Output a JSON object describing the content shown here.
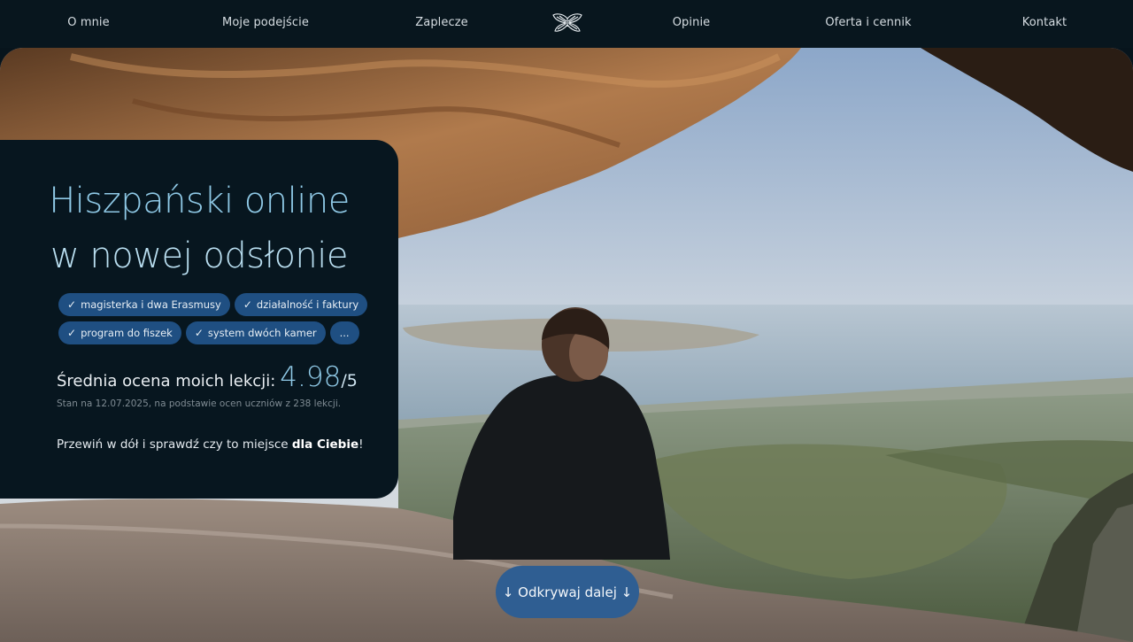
{
  "nav": {
    "items": [
      "O mnie",
      "Moje podejście",
      "Zaplecze",
      "Opinie",
      "Oferta i cennik",
      "Kontakt"
    ],
    "logo_icon": "butterfly-logo-icon"
  },
  "hero": {
    "title_line1": "Hiszpański online",
    "title_line2": "w nowej odsłonie",
    "tags": [
      "magisterka i dwa Erasmusy",
      "działalność i faktury",
      "program do fiszek",
      "system dwóch kamer",
      "..."
    ],
    "check_icon": "check-icon",
    "rating_label": "Średnia ocena moich lekcji:",
    "rating_value": "4.98",
    "rating_max": "/5",
    "rating_note": "Stan na 12.07.2025, na podstawie ocen uczniów z 238 lekcji.",
    "cta_prefix": "Przewiń w dół i sprawdź czy to miejsce ",
    "cta_bold": "dla Ciebie",
    "cta_suffix": "!"
  },
  "discover_button": {
    "label": "↓ Odkrywaj dalej ↓"
  },
  "colors": {
    "page_bg": "#07141c",
    "card_bg": "#07161f",
    "title": "#8fc9e6",
    "tag_bg": "#1f4f82",
    "button_bg": "#2f5e92"
  }
}
